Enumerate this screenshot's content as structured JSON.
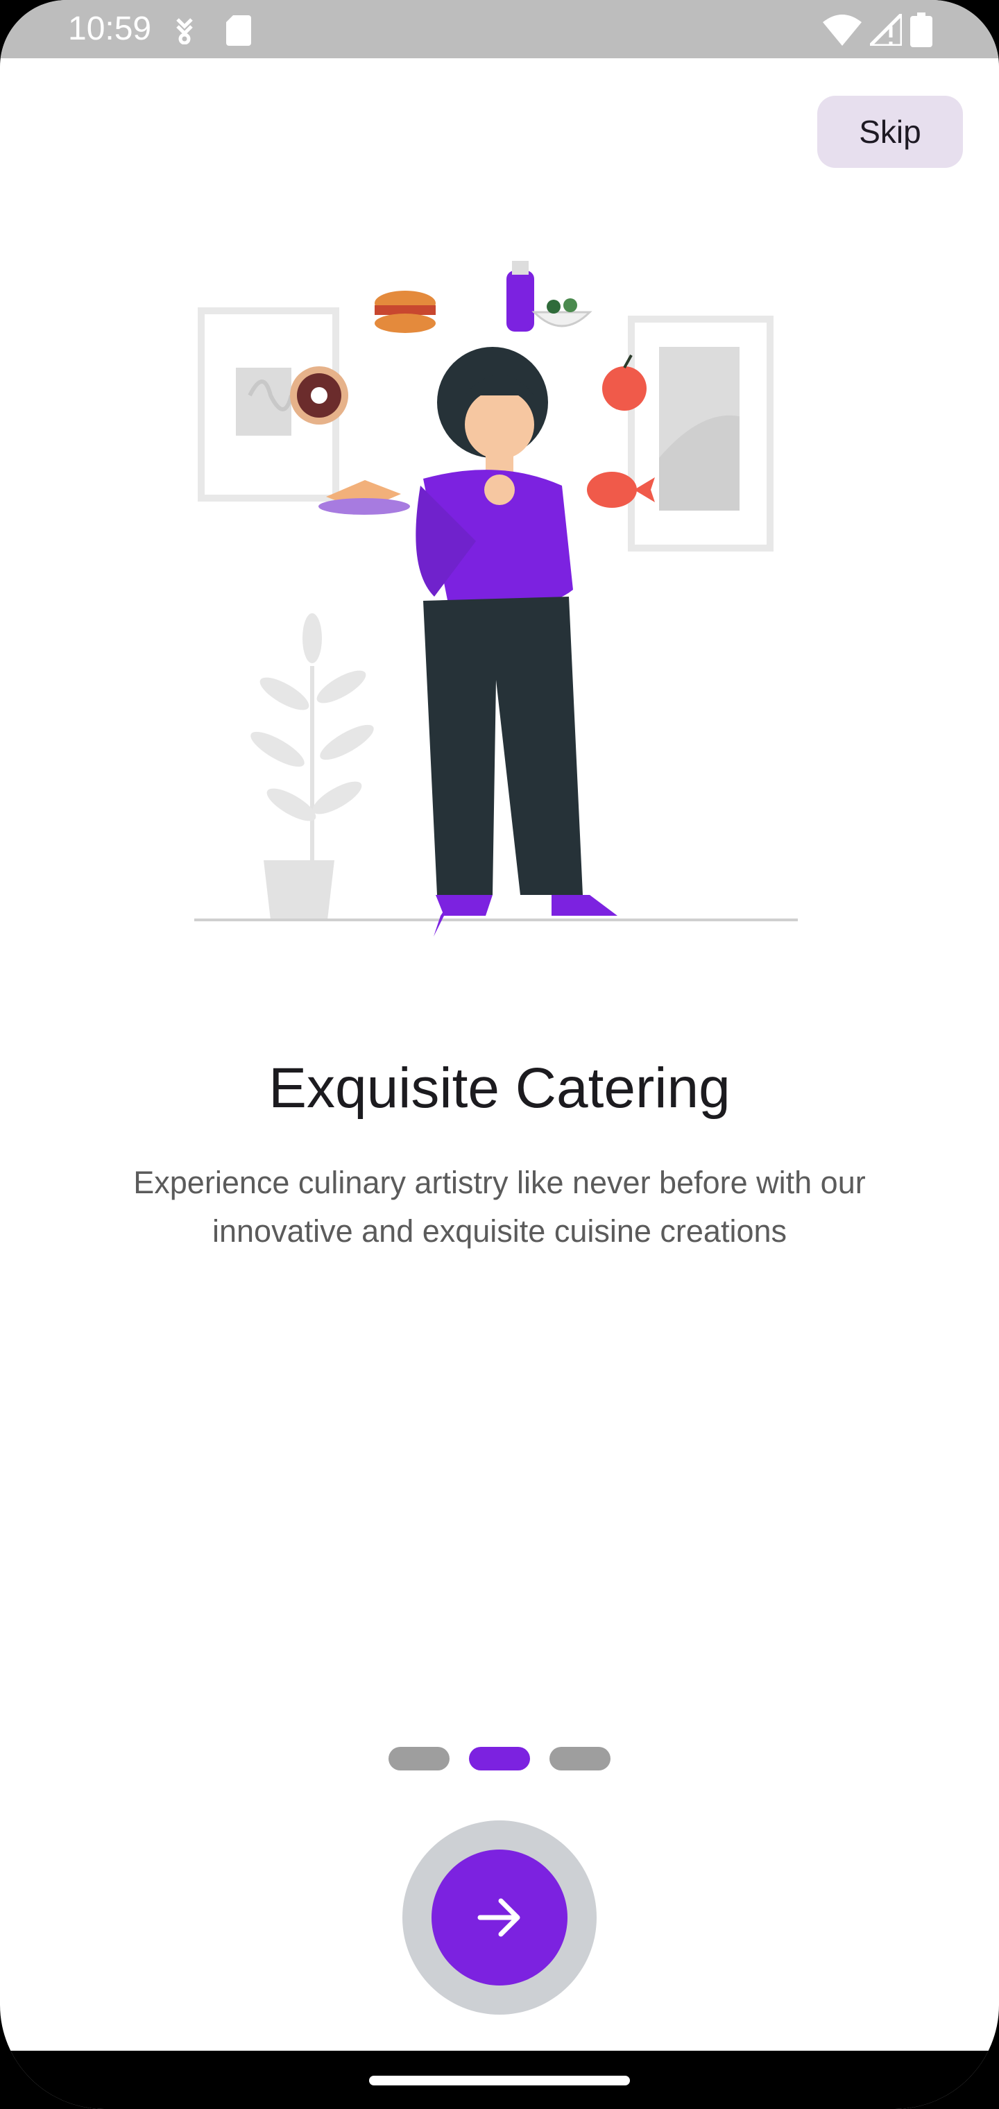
{
  "status_bar": {
    "time": "10:59",
    "left_icons": [
      "vpn-key-icon",
      "sd-card-icon"
    ],
    "right_icons": [
      "wifi-icon",
      "cellular-signal-icon",
      "battery-icon"
    ]
  },
  "header": {
    "skip_label": "Skip"
  },
  "illustration": {
    "subject": "woman choosing food illustration"
  },
  "content": {
    "title": "Exquisite Catering",
    "description": "Experience culinary artistry like never before with our innovative and exquisite cuisine creations"
  },
  "pager": {
    "total": 3,
    "current_index": 1
  },
  "next_button": {
    "icon": "arrow-right-icon"
  },
  "colors": {
    "accent": "#7c22e0",
    "skip_bg": "#e7dfee",
    "inactive_dot": "#9e9e9e"
  }
}
